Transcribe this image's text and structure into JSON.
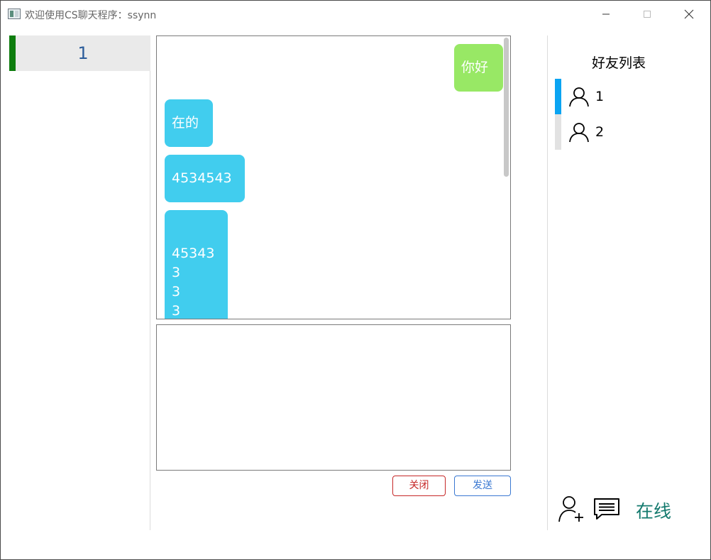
{
  "window": {
    "title": "欢迎使用CS聊天程序：ssynn"
  },
  "conversations": [
    {
      "name": "1",
      "active": true
    }
  ],
  "chat": {
    "messages": [
      {
        "from": "me",
        "text": "你好"
      },
      {
        "from": "other",
        "text": "在的"
      },
      {
        "from": "other",
        "text": "4534543"
      },
      {
        "from": "other",
        "text": "45343\n3\n3\n3"
      }
    ],
    "input_value": ""
  },
  "buttons": {
    "close_label": "关闭",
    "send_label": "发送"
  },
  "friends": {
    "title": "好友列表",
    "items": [
      {
        "name": "1",
        "selected": true
      },
      {
        "name": "2",
        "selected": false
      }
    ]
  },
  "status": {
    "label": "在线"
  },
  "icons": {
    "minimize": "minimize-icon",
    "maximize": "maximize-icon",
    "close": "close-icon",
    "friend": "user-icon",
    "add_friend": "add-user-icon",
    "messages": "message-icon"
  },
  "colors": {
    "conversation_indicator": "#0e7d0e",
    "my_bubble": "#98e865",
    "other_bubble": "#41cdee",
    "close_button": "#c62828",
    "send_button": "#3a78d2",
    "friend_selected_marker": "#0aa4f2",
    "status_online": "#147a6e"
  }
}
